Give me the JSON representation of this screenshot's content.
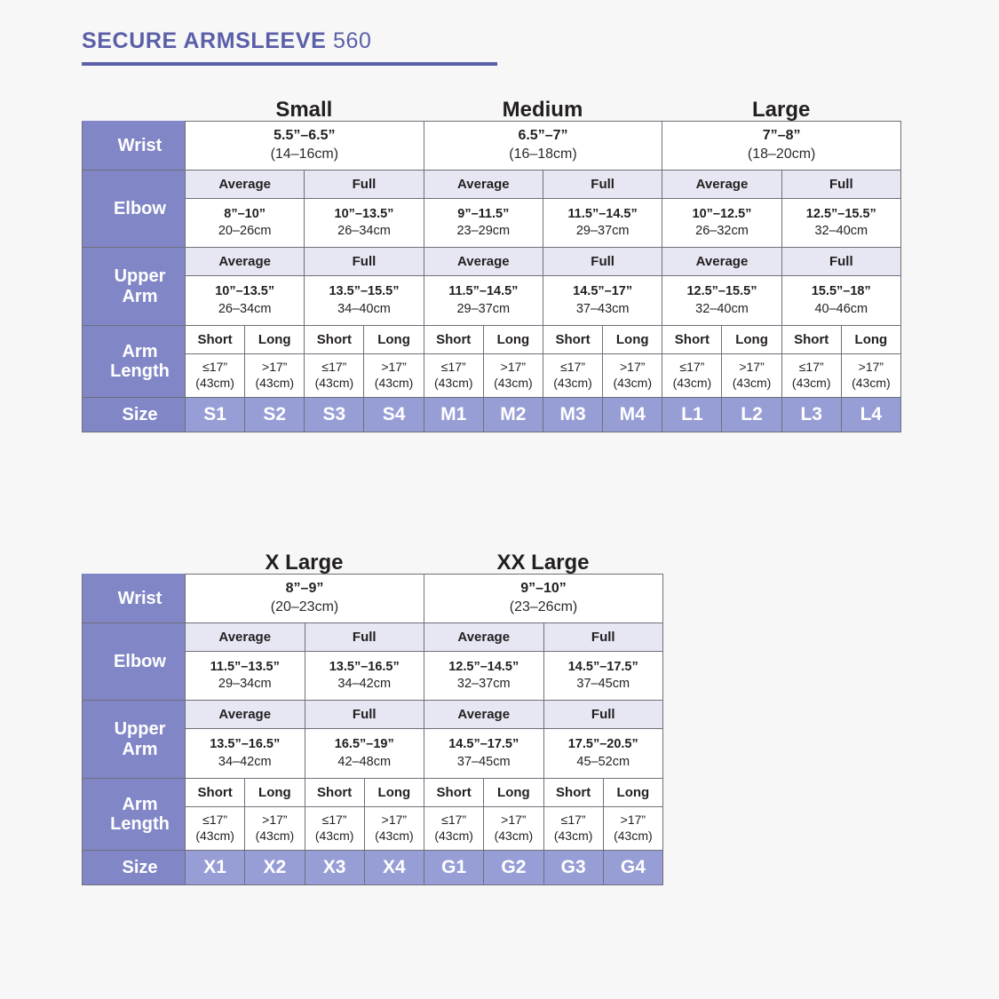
{
  "title": {
    "strong": "SECURE ARMSLEEVE",
    "light": "560"
  },
  "colors": {
    "accent": "#5b5fa8",
    "row_label_bg": "#8187c6",
    "size_cell_bg": "#979ed6",
    "band_bg": "#e7e7f3",
    "page_bg": "#f7f7f7",
    "border": "#6f6f7a"
  },
  "row_labels": {
    "wrist": "Wrist",
    "elbow": "Elbow",
    "upper_arm_line1": "Upper",
    "upper_arm_line2": "Arm",
    "arm_length_line1": "Arm",
    "arm_length_line2": "Length",
    "size": "Size"
  },
  "fit_labels": {
    "average": "Average",
    "full": "Full"
  },
  "length_labels": {
    "short": "Short",
    "long": "Long"
  },
  "arm_length_values": {
    "short_inch": "≤17”",
    "short_cm": "(43cm)",
    "long_inch": ">17”",
    "long_cm": "(43cm)"
  },
  "table1": {
    "groups": [
      {
        "name": "Small",
        "wrist_inch": "5.5”–6.5”",
        "wrist_cm": "(14–16cm)",
        "elbow": [
          {
            "fit": "Average",
            "inch": "8”–10”",
            "cm": "20–26cm"
          },
          {
            "fit": "Full",
            "inch": "10”–13.5”",
            "cm": "26–34cm"
          }
        ],
        "upper_arm": [
          {
            "fit": "Average",
            "inch": "10”–13.5”",
            "cm": "26–34cm"
          },
          {
            "fit": "Full",
            "inch": "13.5”–15.5”",
            "cm": "34–40cm"
          }
        ],
        "sizes": [
          "S1",
          "S2",
          "S3",
          "S4"
        ]
      },
      {
        "name": "Medium",
        "wrist_inch": "6.5”–7”",
        "wrist_cm": "(16–18cm)",
        "elbow": [
          {
            "fit": "Average",
            "inch": "9”–11.5”",
            "cm": "23–29cm"
          },
          {
            "fit": "Full",
            "inch": "11.5”–14.5”",
            "cm": "29–37cm"
          }
        ],
        "upper_arm": [
          {
            "fit": "Average",
            "inch": "11.5”–14.5”",
            "cm": "29–37cm"
          },
          {
            "fit": "Full",
            "inch": "14.5”–17”",
            "cm": "37–43cm"
          }
        ],
        "sizes": [
          "M1",
          "M2",
          "M3",
          "M4"
        ]
      },
      {
        "name": "Large",
        "wrist_inch": "7”–8”",
        "wrist_cm": "(18–20cm)",
        "elbow": [
          {
            "fit": "Average",
            "inch": "10”–12.5”",
            "cm": "26–32cm"
          },
          {
            "fit": "Full",
            "inch": "12.5”–15.5”",
            "cm": "32–40cm"
          }
        ],
        "upper_arm": [
          {
            "fit": "Average",
            "inch": "12.5”–15.5”",
            "cm": "32–40cm"
          },
          {
            "fit": "Full",
            "inch": "15.5”–18”",
            "cm": "40–46cm"
          }
        ],
        "sizes": [
          "L1",
          "L2",
          "L3",
          "L4"
        ]
      }
    ]
  },
  "table2": {
    "groups": [
      {
        "name": "X Large",
        "wrist_inch": "8”–9”",
        "wrist_cm": "(20–23cm)",
        "elbow": [
          {
            "fit": "Average",
            "inch": "11.5”–13.5”",
            "cm": "29–34cm"
          },
          {
            "fit": "Full",
            "inch": "13.5”–16.5”",
            "cm": "34–42cm"
          }
        ],
        "upper_arm": [
          {
            "fit": "Average",
            "inch": "13.5”–16.5”",
            "cm": "34–42cm"
          },
          {
            "fit": "Full",
            "inch": "16.5”–19”",
            "cm": "42–48cm"
          }
        ],
        "sizes": [
          "X1",
          "X2",
          "X3",
          "X4"
        ]
      },
      {
        "name": "XX Large",
        "wrist_inch": "9”–10”",
        "wrist_cm": "(23–26cm)",
        "elbow": [
          {
            "fit": "Average",
            "inch": "12.5”–14.5”",
            "cm": "32–37cm"
          },
          {
            "fit": "Full",
            "inch": "14.5”–17.5”",
            "cm": "37–45cm"
          }
        ],
        "upper_arm": [
          {
            "fit": "Average",
            "inch": "14.5”–17.5”",
            "cm": "37–45cm"
          },
          {
            "fit": "Full",
            "inch": "17.5”–20.5”",
            "cm": "45–52cm"
          }
        ],
        "sizes": [
          "G1",
          "G2",
          "G3",
          "G4"
        ]
      }
    ]
  }
}
